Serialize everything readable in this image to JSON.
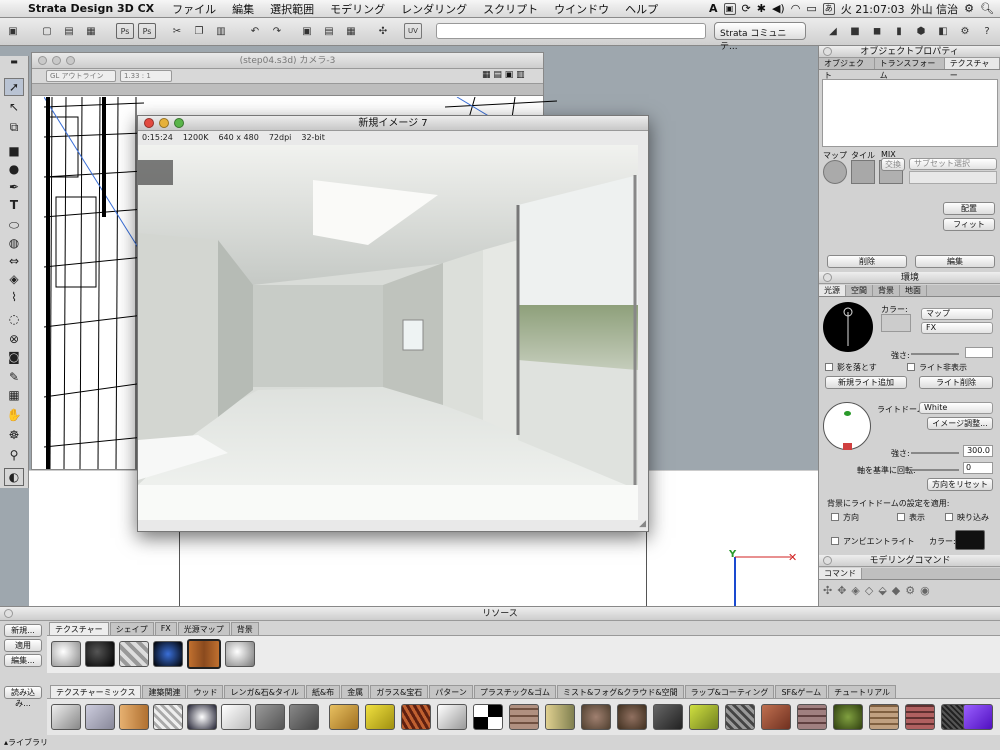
{
  "menubar": {
    "app": "Strata Design 3D CX",
    "items": [
      "ファイル",
      "編集",
      "選択範囲",
      "モデリング",
      "レンダリング",
      "スクリプト",
      "ウインドウ",
      "ヘルプ"
    ],
    "clock": "火 21:07:03",
    "user": "外山 信治"
  },
  "toolbar": {
    "community": "Strata コミュニテ..."
  },
  "editor": {
    "title": "(step04.s3d) カメラ-3",
    "mode": "GL アウトライン",
    "zoom": "1.33 : 1"
  },
  "render": {
    "title": "新規イメージ 7",
    "time": "0:15:24",
    "size": "1200K",
    "dims": "640 x 480",
    "dpi": "72dpi",
    "bits": "32-bit"
  },
  "props": {
    "title": "オブジェクトプロパティ",
    "tabs": [
      "オブジェクト",
      "トランスフォーム",
      "テクスチャー"
    ],
    "map_labels": [
      "マップ",
      "タイル",
      "MIX"
    ],
    "exchange": "交換",
    "subset": "サブセット選択",
    "btn_place": "配置",
    "btn_fit": "フィット",
    "btn_delete": "削除",
    "btn_edit": "編集"
  },
  "env": {
    "title": "環境",
    "tabs": [
      "光源",
      "空間",
      "背景",
      "地面"
    ],
    "color_label": "カラー:",
    "map_sel": "マップ",
    "fx_sel": "FX",
    "intensity_label": "強さ:",
    "cast_shadow": "影を落とす",
    "hide_light": "ライト非表示",
    "add_light": "新規ライト追加",
    "del_light": "ライト削除",
    "dome_label": "ライトドーム:",
    "dome_value": "White",
    "image_adjust": "イメージ調整...",
    "strength_label": "強さ:",
    "strength_value": "300.0",
    "rotate_label": "軸を基準に回転:",
    "rotate_value": "0",
    "reset_dir": "方向をリセット",
    "apply_label": "背景にライトドームの設定を適用:",
    "apply_dir": "方向",
    "apply_show": "表示",
    "apply_reflect": "映り込み",
    "ambient": "アンビエントライト",
    "ambient_color": "カラー:"
  },
  "modeling": {
    "title": "モデリングコマンド",
    "tab": "コマンド"
  },
  "resources": {
    "title": "リソース",
    "new_btn": "新規...",
    "apply_btn": "適用",
    "edit_btn": "編集...",
    "load_btn": "読み込み...",
    "tabs": [
      "テクスチャー",
      "シェイプ",
      "FX",
      "光源マップ",
      "背景"
    ],
    "library_tabs": [
      "テクスチャーミックス",
      "建築関連",
      "ウッド",
      "レンガ&石&タイル",
      "紙&布",
      "金属",
      "ガラス&宝石",
      "パターン",
      "プラスチック&ゴム",
      "ミスト&フォグ&クラウド&空間",
      "ラップ&コーティング",
      "SF&ゲーム",
      "チュートリアル"
    ],
    "library_label": "ライブラリ"
  },
  "colors": {
    "accent": "#3a6fd8",
    "selected_swatch": "#c0702f"
  }
}
